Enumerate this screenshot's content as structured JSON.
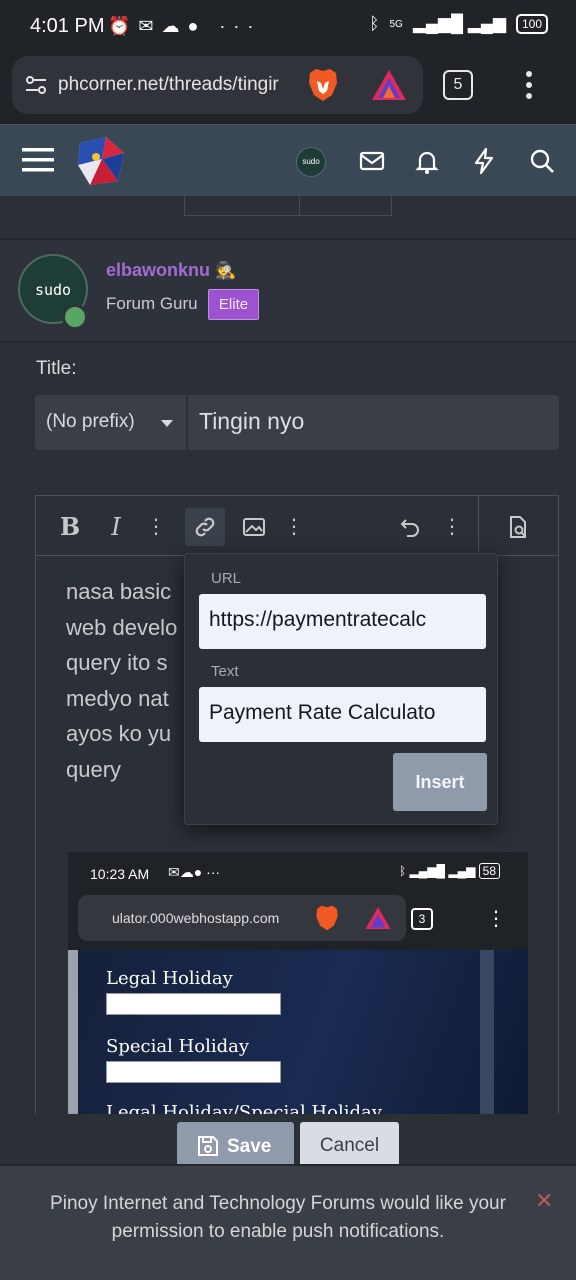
{
  "status_bar": {
    "time": "4:01 PM",
    "network": "5G",
    "battery": "100"
  },
  "browser": {
    "url": "phcorner.net/threads/tingir",
    "tab_count": "5"
  },
  "forum_header": {
    "avatar_text": "sudo"
  },
  "post_author": {
    "username": "elbawonknu",
    "role": "Forum Guru",
    "badge": "Elite",
    "avatar_text": "sudo"
  },
  "form": {
    "title_label": "Title:",
    "prefix": "(No prefix)",
    "title_value": "Tingin nyo"
  },
  "editor": {
    "body_lines": [
      "nasa basic",
      "web develo",
      "query ito s",
      "medyo nat",
      "ayos ko yu",
      "query"
    ]
  },
  "embedded_screenshot": {
    "time": "10:23 AM",
    "battery": "58",
    "url": "ulator.000webhostapp.com",
    "tab_count": "3",
    "label1": "Legal Holiday",
    "label2": "Special Holiday",
    "label3": "Legal Holiday/Special Holiday"
  },
  "link_popup": {
    "url_label": "URL",
    "url_value": "https://paymentratecalc",
    "text_label": "Text",
    "text_value": "Payment Rate Calculato",
    "insert_label": "Insert"
  },
  "actions": {
    "save_label": "Save",
    "cancel_label": "Cancel"
  },
  "notification": {
    "message": "Pinoy Internet and Technology Forums would like your permission to enable push notifications."
  }
}
